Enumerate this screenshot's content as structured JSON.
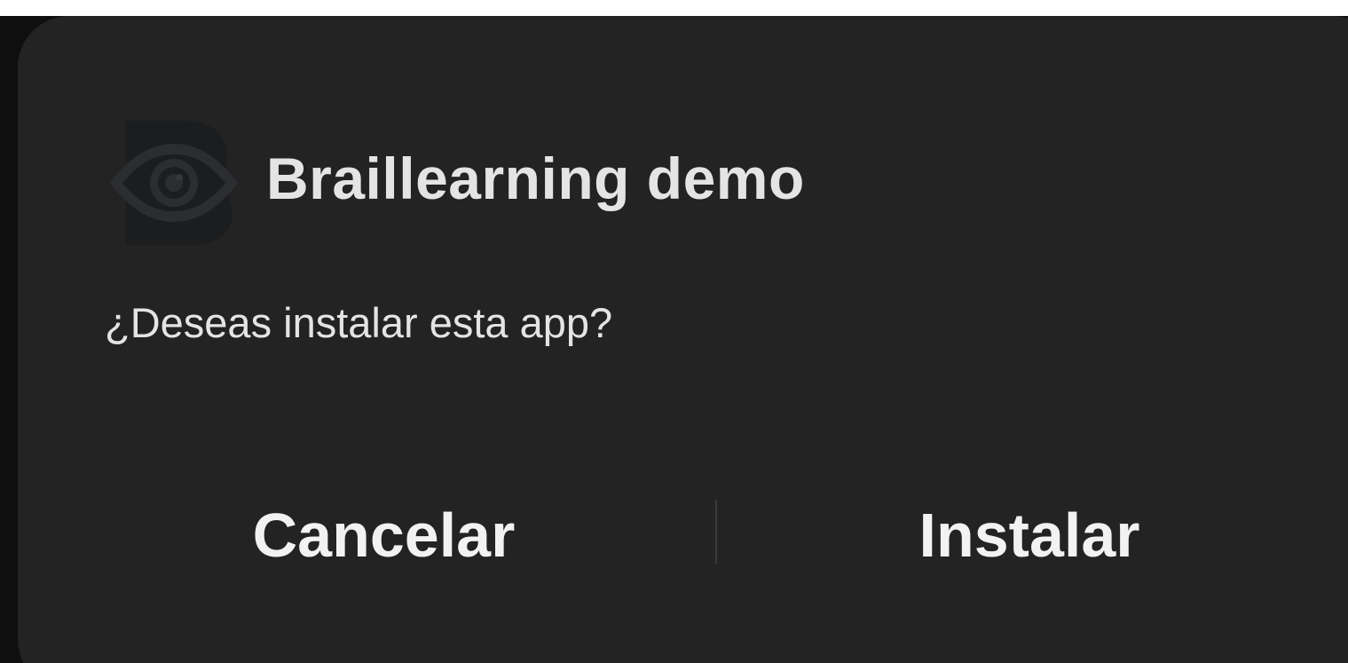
{
  "dialog": {
    "app_name": "Braillearning demo",
    "app_icon": "braillearning-eye-logo",
    "prompt": "¿Deseas instalar esta app?",
    "cancel_label": "Cancelar",
    "install_label": "Instalar"
  },
  "colors": {
    "dialog_background": "#232323",
    "text_primary": "#e4e4e4",
    "button_text": "#f2f2f2",
    "divider": "#3a3a3a"
  }
}
